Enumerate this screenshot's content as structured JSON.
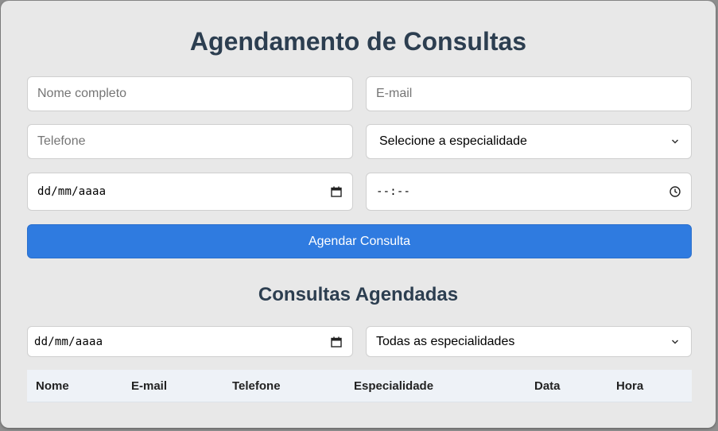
{
  "page": {
    "title": "Agendamento de Consultas",
    "subtitle": "Consultas Agendadas"
  },
  "form": {
    "name_placeholder": "Nome completo",
    "email_placeholder": "E-mail",
    "phone_placeholder": "Telefone",
    "specialty_value": "Selecione a especialidade",
    "date_value": "dd/mm/aaaa",
    "time_value": "--:--",
    "submit_label": "Agendar Consulta"
  },
  "filters": {
    "date_value": "dd/mm/aaaa",
    "specialty_value": "Todas as especialidades"
  },
  "table": {
    "headers": [
      "Nome",
      "E-mail",
      "Telefone",
      "Especialidade",
      "Data",
      "Hora"
    ]
  },
  "icons": {
    "calendar": "calendar-icon",
    "clock": "clock-icon",
    "chevron": "chevron-down-icon"
  },
  "colors": {
    "accent": "#2f7be0",
    "heading": "#2c3e50",
    "background": "#e8e8e8"
  }
}
